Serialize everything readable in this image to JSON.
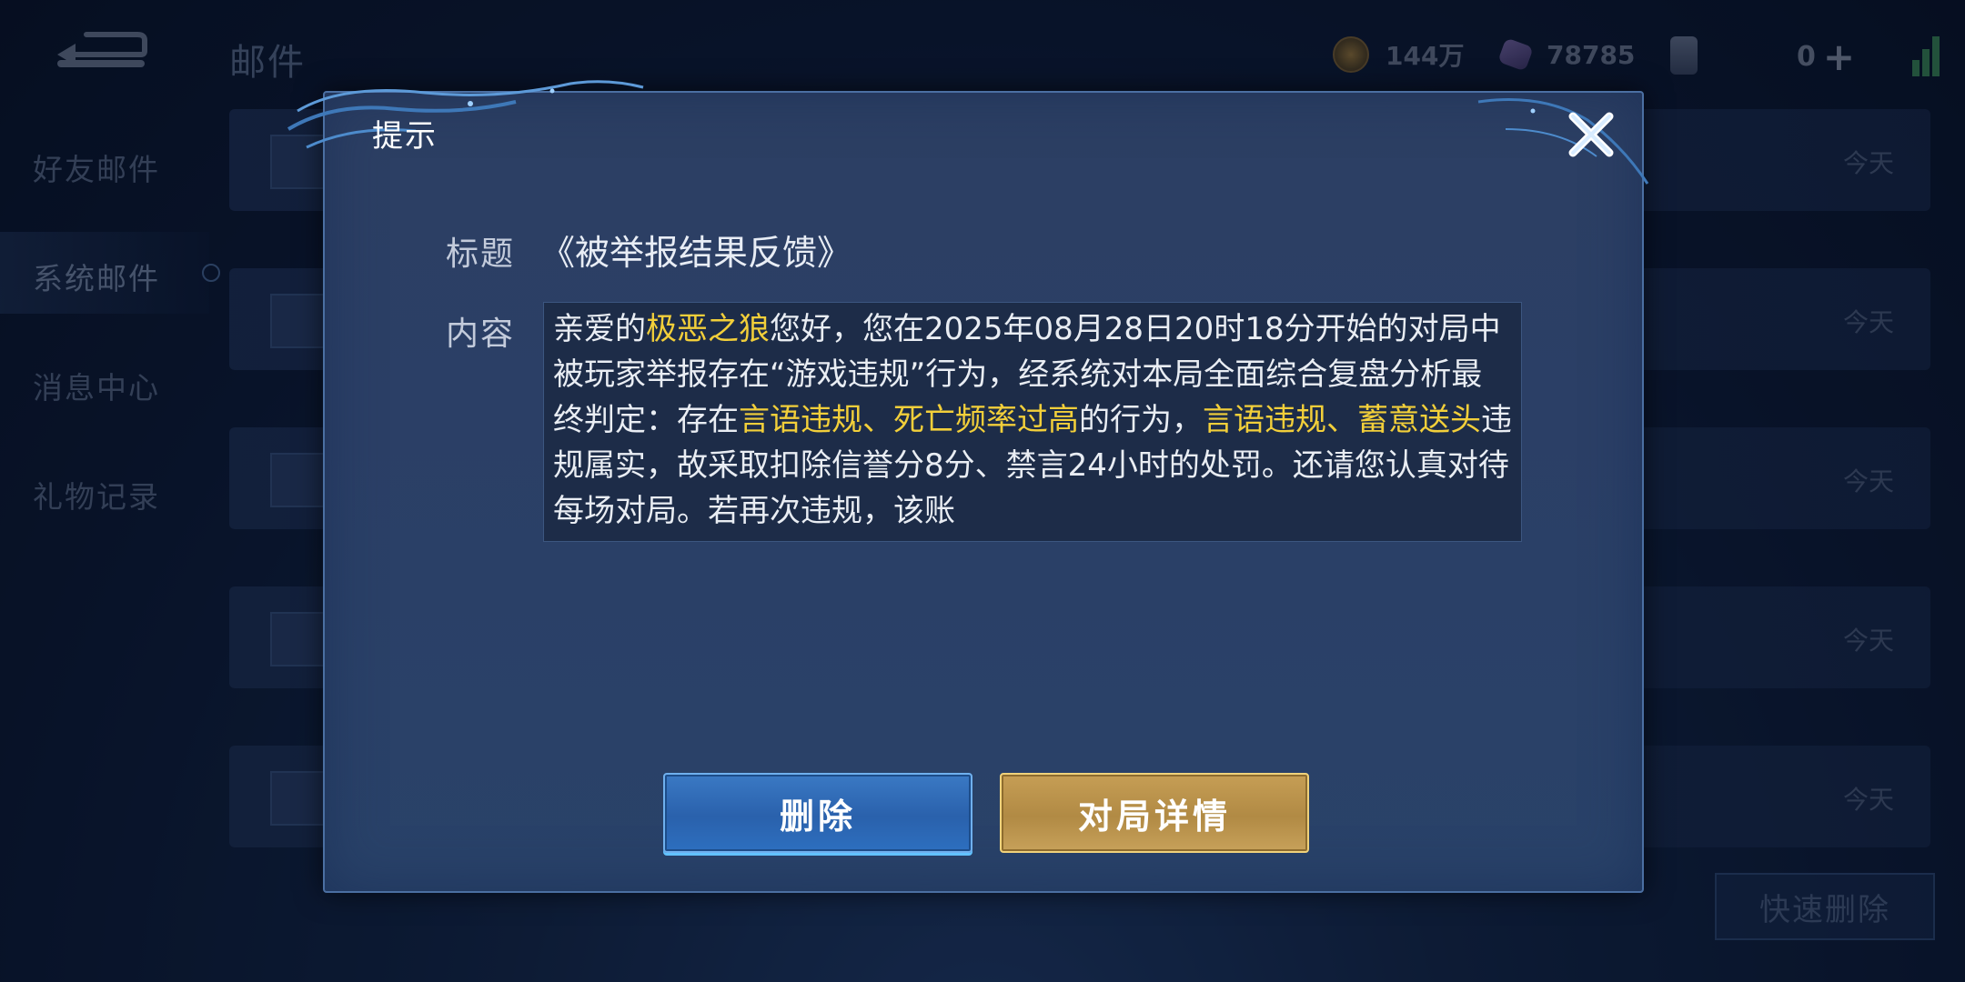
{
  "header": {
    "page_title": "邮件",
    "coins": "144万",
    "gems": "78785",
    "vouchers": "0"
  },
  "sidebar": {
    "items": [
      {
        "label": "好友邮件"
      },
      {
        "label": "系统邮件"
      },
      {
        "label": "消息中心"
      },
      {
        "label": "礼物记录"
      }
    ],
    "active_index": 1
  },
  "mail_list": {
    "rows": [
      {
        "date": "今天"
      },
      {
        "date": "今天"
      },
      {
        "date": "今天"
      },
      {
        "date": "今天"
      },
      {
        "date": "今天"
      }
    ],
    "quick_delete_label": "快速删除"
  },
  "dialog": {
    "title": "提示",
    "subject_label": "标题",
    "subject_value": "《被举报结果反馈》",
    "content_label": "内容",
    "content_segments": [
      {
        "text": "亲爱的",
        "highlight": false
      },
      {
        "text": "极恶之狼",
        "highlight": true
      },
      {
        "text": "您好，您在2025年08月28日20时18分开始的对局中被玩家举报存在“游戏违规”行为，经系统对本局全面综合复盘分析最终判定：存在",
        "highlight": false
      },
      {
        "text": "言语违规、死亡频率过高",
        "highlight": true
      },
      {
        "text": "的行为，",
        "highlight": false
      },
      {
        "text": "言语违规、蓄意送头",
        "highlight": true
      },
      {
        "text": "违规属实，故采取扣除信誉分8分、禁言24小时的处罚。还请您认真对待每场对局。若再次违规，该账",
        "highlight": false
      }
    ],
    "delete_button": "删除",
    "details_button": "对局详情"
  },
  "colors": {
    "highlight": "#f2cf3a",
    "delete_button": "#2a61ac",
    "details_button": "#b18a44"
  }
}
